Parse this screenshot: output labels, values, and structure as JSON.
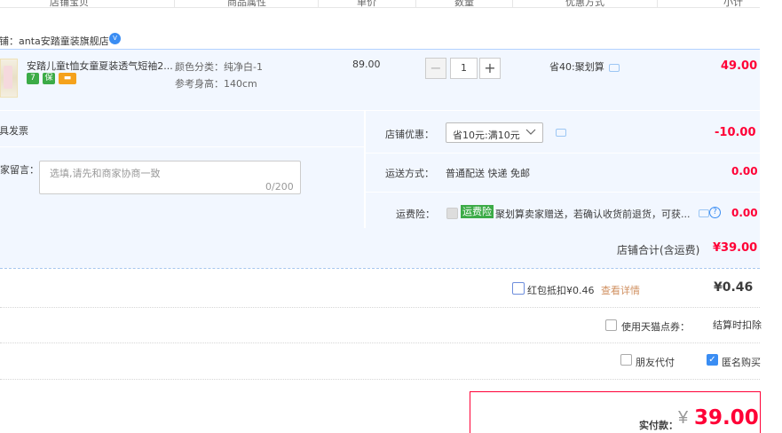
{
  "header": {
    "columns": [
      "店铺宝贝",
      "商品属性",
      "单价",
      "数量",
      "优惠方式",
      "小计"
    ]
  },
  "shop": {
    "name": "店铺：anta安踏童装旗舰店",
    "badge": "V"
  },
  "item": {
    "title": "安踏儿童t恤女童夏装透气短袖2...",
    "sku_color": "颜色分类：纯净白-1",
    "sku_height": "参考身高：140cm",
    "price": "89.00",
    "quantity": "1",
    "minus": "−",
    "plus": "+",
    "promo": "省40:聚划算",
    "subtotal": "49.00",
    "icons": [
      {
        "name": "seven-day-return-icon",
        "glyph": "7",
        "color": "#3cab47"
      },
      {
        "name": "guarantee-icon",
        "glyph": "保",
        "color": "#3cab47"
      },
      {
        "name": "credit-card-icon",
        "glyph": "▬",
        "color": "#f5a21c"
      }
    ]
  },
  "invoice": {
    "label": "开具发票"
  },
  "message": {
    "label": "给卖家留言：",
    "placeholder": "选填,请先和商家协商一致",
    "count": "0/200"
  },
  "coupon": {
    "label": "店铺优惠：",
    "value": "省10元:满10元",
    "amount": "-10.00"
  },
  "shipping": {
    "label": "运送方式：",
    "value": "普通配送 快递 免邮",
    "amount": "0.00"
  },
  "insurance": {
    "label": "运费险：",
    "badge": "运费险",
    "text": "聚划算卖家赠送，若确认收货前退货，可获...",
    "amount": "0.00"
  },
  "shop_total": {
    "label": "店铺合计(含运费)",
    "value": "¥39.00"
  },
  "red_packet": {
    "label": "红包抵扣¥0.46",
    "link": "查看详情",
    "amount": "¥0.46"
  },
  "tmall_points": {
    "label": "使用天猫点券：",
    "note": "结算时扣除"
  },
  "options": {
    "friend_pay": "朋友代付",
    "anonymous": "匿名购买"
  },
  "payment": {
    "label": "实付款：",
    "currency": "¥",
    "amount": "39.00"
  },
  "colors": {
    "accent_red": "#ff0036",
    "accent_blue": "#3a8df3",
    "panel_bg": "#f2f7ff"
  }
}
